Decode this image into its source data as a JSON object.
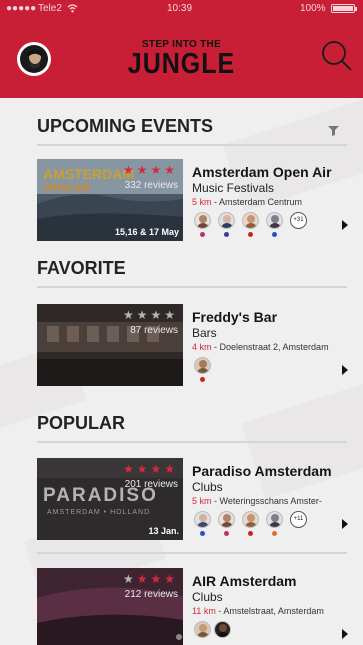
{
  "status_bar": {
    "signal": "●●●●●",
    "carrier": "Tele2",
    "time": "10:39",
    "battery": "100%",
    "battery_level": 1.0
  },
  "header": {
    "logo_top": "STEP INTO THE",
    "logo_main": "JUNGLE",
    "accent_color": "#c91f36"
  },
  "sections": {
    "upcoming": "UPCOMING EVENTS",
    "favorite": "FAVORITE",
    "popular": "POPULAR"
  },
  "events": [
    {
      "title": "Amsterdam Open Air",
      "category": "Music Festivals",
      "distance": "5 km",
      "location": " - Amsterdam Centrum",
      "reviews": "332 reviews",
      "rating": 4,
      "date": "15,16 & 17 May",
      "attendees": 4,
      "more": "+31"
    },
    {
      "title": "Freddy's Bar",
      "category": "Bars",
      "distance": "4 km",
      "location": " - Doelenstraat 2, Amsterdam",
      "reviews": "87 reviews",
      "rating": 0,
      "date": "",
      "attendees": 1,
      "more": ""
    },
    {
      "title": "Paradiso Amsterdam",
      "category": "Clubs",
      "distance": "5 km",
      "location": " - Weteringsschans Amster-",
      "reviews": "201 reviews",
      "rating": 4,
      "date": "13 Jan.",
      "thumb_text": "PARADISO",
      "thumb_subtext": "AMSTERDAM • HOLLAND",
      "attendees": 4,
      "more": "+11"
    },
    {
      "title": "AIR Amsterdam",
      "category": "Clubs",
      "distance": "11 km",
      "location": " - Amstelstraat, Amsterdam",
      "reviews": "212 reviews",
      "rating": 3,
      "date": "",
      "attendees": 2,
      "more": ""
    }
  ],
  "icons": {
    "profile": "avatar-icon",
    "search": "search-icon",
    "filter": "filter-icon",
    "arrow": "chevron-right-icon"
  }
}
